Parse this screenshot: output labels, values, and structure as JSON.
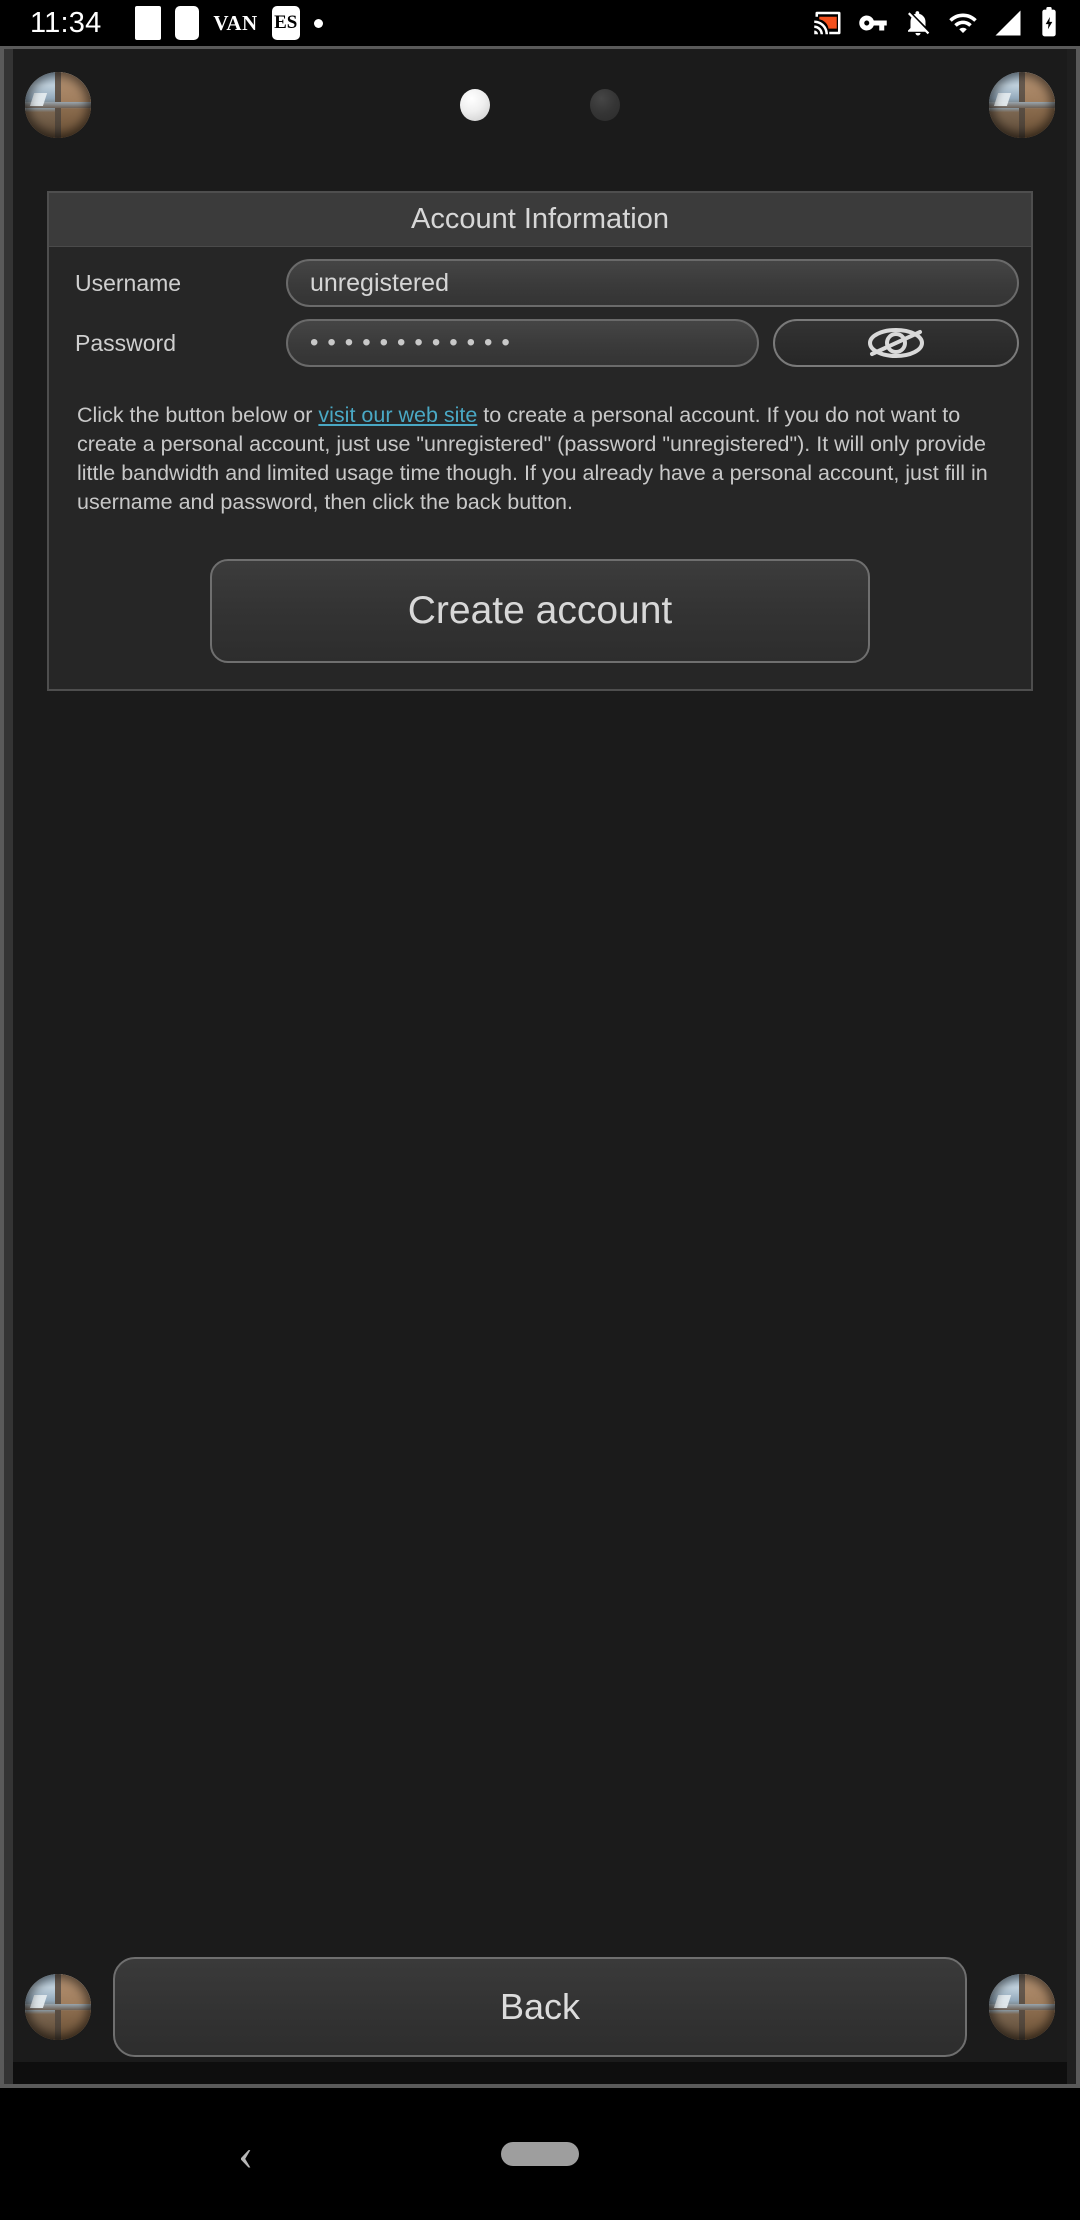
{
  "status_bar": {
    "time": "11:34",
    "left_icons": [
      "white-square-icon",
      "white-rounded-square-icon",
      "vpn-label-icon",
      "es-app-icon",
      "small-dot-icon"
    ],
    "van_label": "VAN",
    "es_label": "ES",
    "right_icons": [
      "cast-icon",
      "vpn-key-icon",
      "notifications-off-icon",
      "wifi-icon",
      "cellular-signal-icon",
      "battery-charging-icon"
    ],
    "cast_accent_color": "#f4511e"
  },
  "top_bar": {
    "left_avatar": "window-avatar-icon",
    "right_avatar": "window-avatar-icon",
    "page_indicator": {
      "count": 2,
      "active_index": 0
    }
  },
  "panel": {
    "title": "Account Information",
    "username": {
      "label": "Username",
      "value": "unregistered",
      "placeholder": "unregistered"
    },
    "password": {
      "label": "Password",
      "masked_value": "••••••••••••",
      "char_count": 12,
      "toggle_icon": "eye-slash-icon",
      "visible": false
    },
    "blurb": {
      "before_link": "Click the button below or ",
      "link_text": "visit our web site",
      "after_link": " to create a personal account. If you do not want to create a personal account, just use \"unregistered\" (password \"unregistered\"). It will only provide little bandwidth and limited usage time though. If you already have a personal account, just fill in username and password, then click the back button."
    },
    "create_account_label": "Create account"
  },
  "bottom_bar": {
    "left_avatar": "window-avatar-icon",
    "right_avatar": "window-avatar-icon",
    "back_label": "Back"
  },
  "navigation_bar": {
    "back_glyph": "‹",
    "home_pill": "home-pill-icon"
  },
  "colors": {
    "window_background": "#1b1b1b",
    "panel_background": "#262626",
    "panel_title_background": "#3b3b3b",
    "link": "#4aa8c4",
    "text_primary": "#d7d7d7",
    "border": "#6f6f6f"
  }
}
